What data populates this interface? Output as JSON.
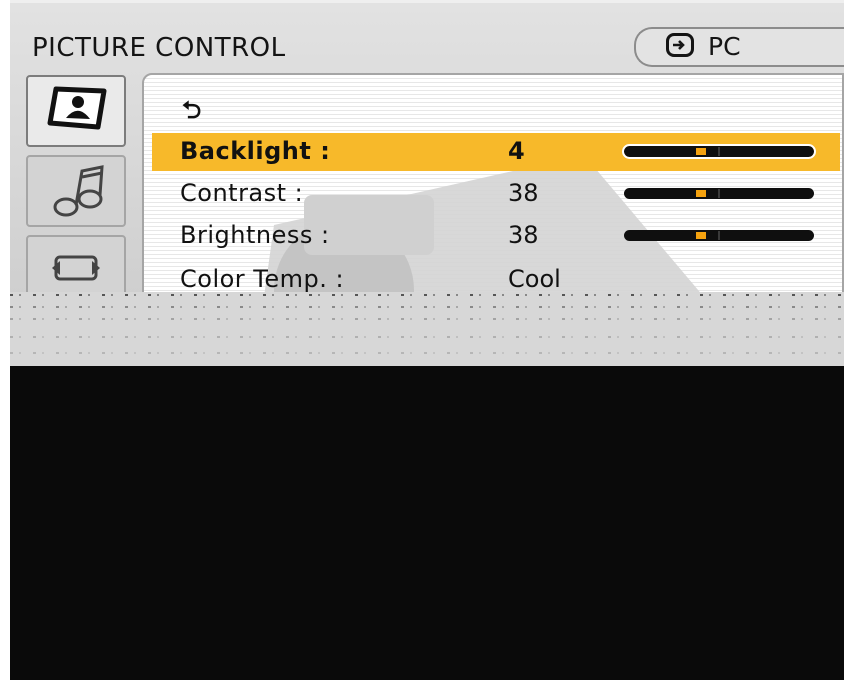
{
  "osd": {
    "title": "PICTURE CONTROL",
    "source_label": "PC",
    "source_icon": "input-source-icon",
    "accent_color": "#f7b92a",
    "slider_knob_color": "#f5a20f"
  },
  "tabs": [
    {
      "name": "picture",
      "icon": "picture-icon",
      "active": true
    },
    {
      "name": "sound",
      "icon": "music-note-icon",
      "active": false
    },
    {
      "name": "setup",
      "icon": "setup-icon",
      "active": false
    }
  ],
  "menu": {
    "back_icon": "⮌",
    "items": [
      {
        "label": "Backlight :",
        "value": "4",
        "level": 0.4,
        "selected": true
      },
      {
        "label": "Contrast :",
        "value": "38",
        "level": 0.4,
        "selected": false
      },
      {
        "label": "Brightness :",
        "value": "38",
        "level": 0.4,
        "selected": false
      },
      {
        "label": "Color Temp. :",
        "value": "Cool",
        "selected": false
      }
    ]
  }
}
